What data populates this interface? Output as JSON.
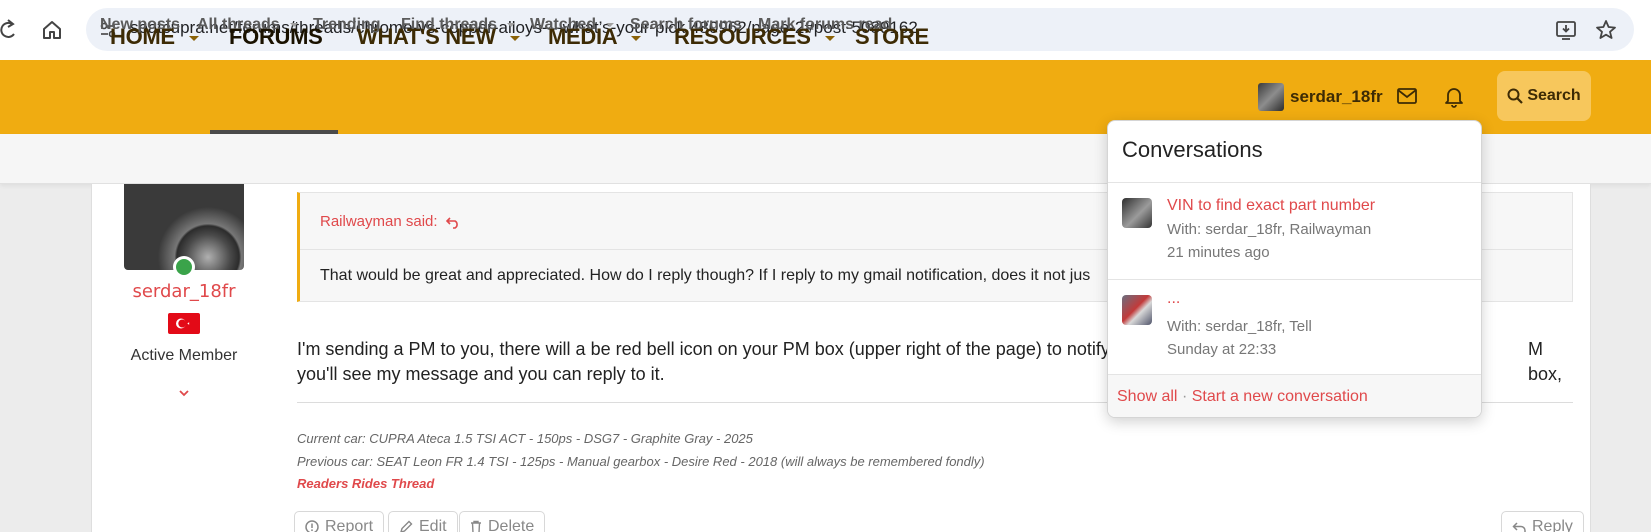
{
  "browser": {
    "url": "seatcupra.net/forums/threads/chrome-vs-copper-alloys-–-what’s-your-pick.480962/page-2#post-5089162"
  },
  "nav": {
    "items": [
      {
        "label": "HOME",
        "has_menu": true
      },
      {
        "label": "FORUMS",
        "has_menu": false,
        "active": true
      },
      {
        "label": "WHAT'S NEW",
        "has_menu": true
      },
      {
        "label": "MEDIA",
        "has_menu": true
      },
      {
        "label": "RESOURCES",
        "has_menu": true
      },
      {
        "label": "STORE",
        "has_menu": false
      }
    ],
    "user_name": "serdar_18fr",
    "search_label": "Search",
    "accent_color": "#f0ac11"
  },
  "sub_nav": {
    "items": [
      {
        "label": "New posts",
        "has_menu": false
      },
      {
        "label": "All threads",
        "has_menu": true
      },
      {
        "label": "Trending",
        "has_menu": false
      },
      {
        "label": "Find threads",
        "has_menu": true
      },
      {
        "label": "Watched",
        "has_menu": true
      },
      {
        "label": "Search forums",
        "has_menu": false
      },
      {
        "label": "Mark forums read",
        "has_menu": false
      }
    ]
  },
  "post": {
    "author": "serdar_18fr",
    "author_title": "Active Member",
    "quote_author": "Railwayman said:",
    "quote_text": "That would be great and appreciated. How do I reply though? If I reply to my gmail notification, does it not jus",
    "body_line1": "I'm sending a PM to you, there will a be red bell icon on your PM box (upper right of the page) to notify y",
    "body_line1_tail": "M box,",
    "body_line2": "you'll see my message and you can reply to it.",
    "signature": {
      "current_car": "Current car: CUPRA Ateca 1.5 TSI ACT - 150ps - DSG7 - Graphite Gray - 2025",
      "previous_car": "Previous car: SEAT Leon FR 1.4 TSI - 125ps - Manual gearbox - Desire Red - 2018 (will always be remembered fondly)",
      "link": "Readers Rides Thread"
    },
    "actions": {
      "report": "Report",
      "edit": "Edit",
      "delete": "Delete",
      "reply": "Reply"
    }
  },
  "conversations": {
    "title": "Conversations",
    "items": [
      {
        "subject": "VIN to find exact part number",
        "with": "With: serdar_18fr, Railwayman",
        "time": "21 minutes ago"
      },
      {
        "subject": "...",
        "with": "With: serdar_18fr, Tell",
        "time": "Sunday at 22:33"
      }
    ],
    "show_all": "Show all",
    "separator": "·",
    "start_new": "Start a new conversation"
  }
}
